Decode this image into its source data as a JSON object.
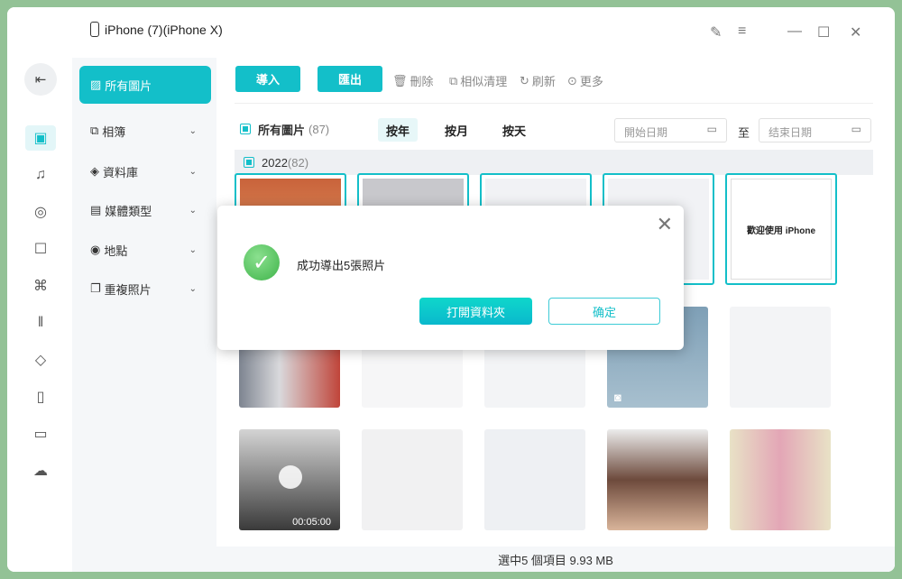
{
  "window": {
    "title": "iPhone (7)(iPhone X)"
  },
  "sidebar": {
    "items": [
      {
        "label": "所有圖片",
        "icon": "image-icon"
      },
      {
        "label": "相簿",
        "icon": "album-icon"
      },
      {
        "label": "資料庫",
        "icon": "layers-icon"
      },
      {
        "label": "媒體類型",
        "icon": "media-icon"
      },
      {
        "label": "地點",
        "icon": "location-icon"
      },
      {
        "label": "重複照片",
        "icon": "duplicate-icon"
      }
    ]
  },
  "toolbar": {
    "import": "導入",
    "export": "匯出",
    "delete": "刪除",
    "similar": "相似清理",
    "refresh": "刷新",
    "more": "更多"
  },
  "filter": {
    "all_label": "所有圖片",
    "all_count": "(87)",
    "by_year": "按年",
    "by_month": "按月",
    "by_day": "按天",
    "start_placeholder": "開始日期",
    "to": "至",
    "end_placeholder": "结束日期"
  },
  "group": {
    "year": "2022",
    "count": "(82)"
  },
  "thumbs": {
    "welcome": "歡迎使用 iPhone",
    "video_duration": "00:05:00"
  },
  "status": "選中5 個項目 9.93 MB",
  "dialog": {
    "message": "成功導出5張照片",
    "open_folder": "打開資料夾",
    "confirm": "确定"
  },
  "colors": {
    "accent": "#13bfc9",
    "success": "#3fb44a"
  }
}
